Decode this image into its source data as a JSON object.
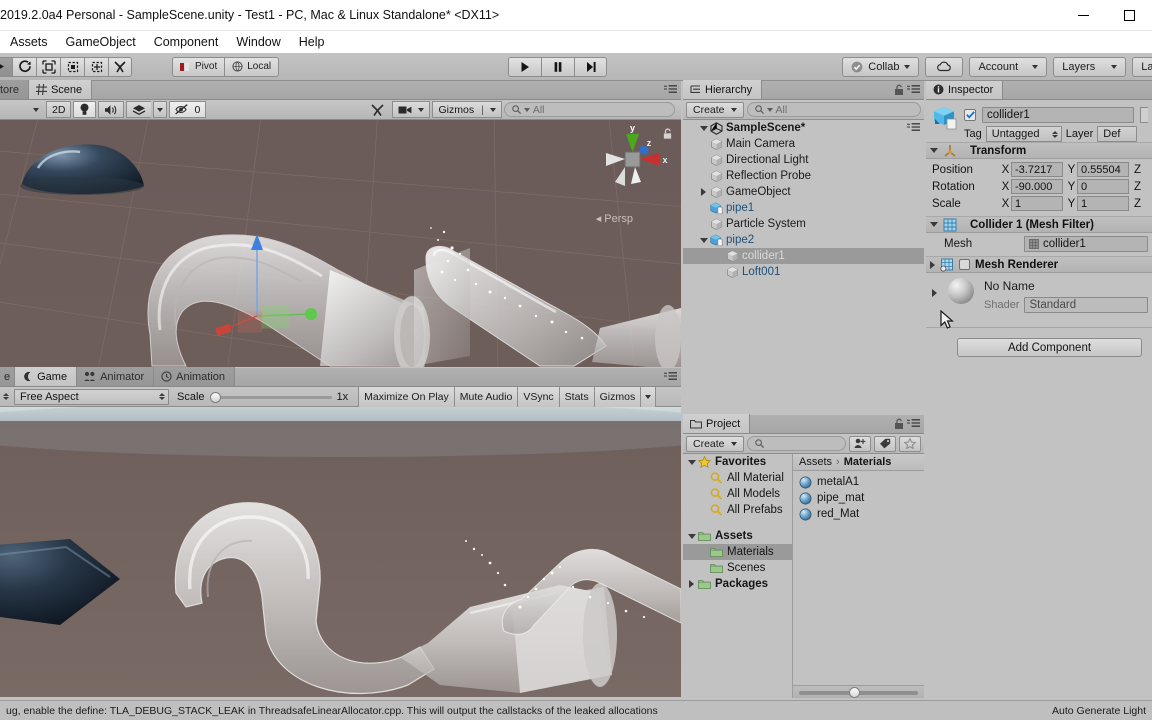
{
  "window": {
    "title": "2019.2.0a4 Personal - SampleScene.unity - Test1 - PC, Mac & Linux Standalone* <DX11>",
    "minimize_icon": "minimize-icon",
    "maximize_icon": "maximize-icon"
  },
  "menubar": {
    "items": [
      "Assets",
      "GameObject",
      "Component",
      "Window",
      "Help"
    ]
  },
  "toolbar": {
    "transform_tools": [
      "hand-tool",
      "move-tool",
      "rotate-tool",
      "scale-tool",
      "rect-tool",
      "transform-tool"
    ],
    "pivot_label": "Pivot",
    "local_label": "Local",
    "play_label": "play-icon",
    "pause_label": "pause-icon",
    "step_label": "step-icon",
    "collab_label": "Collab",
    "cloud_label": "cloud-icon",
    "account_label": "Account",
    "layers_label": "Layers",
    "layout_label": "Lay"
  },
  "scene_view": {
    "tab_partial": "tore",
    "tab_label": "Scene",
    "toolbar": {
      "draw_mode": "",
      "two_d": "2D",
      "lighting": "light-icon",
      "audio": "audio-icon",
      "fx": "fx-icon",
      "hidden_count": "0",
      "tools": "tools-icon",
      "camera": "camera-icon",
      "gizmos": "Gizmos",
      "search_placeholder": "All"
    },
    "gizmo": {
      "x": "x",
      "y": "y",
      "z": "z",
      "projection": "Persp"
    }
  },
  "game_view": {
    "tabs": [
      {
        "label": "Game",
        "icon": "game-icon",
        "active": true
      },
      {
        "label": "Animator",
        "icon": "animator-icon",
        "active": false
      },
      {
        "label": "Animation",
        "icon": "animation-icon",
        "active": false
      }
    ],
    "toolbar": {
      "aspect": "Free Aspect",
      "scale_label": "Scale",
      "scale_value": "1x",
      "maximize": "Maximize On Play",
      "mute": "Mute Audio",
      "vsync": "VSync",
      "stats": "Stats",
      "gizmos": "Gizmos"
    }
  },
  "hierarchy": {
    "tab_label": "Hierarchy",
    "create_label": "Create",
    "search_placeholder": "All",
    "scene_name": "SampleScene*",
    "items": [
      {
        "label": "Main Camera",
        "indent": 2,
        "expandable": false,
        "expanded": false,
        "icon": "gameobject-icon",
        "selected": false
      },
      {
        "label": "Directional Light",
        "indent": 2,
        "expandable": false,
        "expanded": false,
        "icon": "gameobject-icon",
        "selected": false
      },
      {
        "label": "Reflection Probe",
        "indent": 2,
        "expandable": false,
        "expanded": false,
        "icon": "gameobject-icon",
        "selected": false
      },
      {
        "label": "GameObject",
        "indent": 2,
        "expandable": true,
        "expanded": false,
        "icon": "gameobject-icon",
        "selected": false
      },
      {
        "label": "pipe1",
        "indent": 2,
        "expandable": false,
        "expanded": false,
        "icon": "prefab-icon",
        "selected": false
      },
      {
        "label": "Particle System",
        "indent": 2,
        "expandable": false,
        "expanded": false,
        "icon": "gameobject-icon",
        "selected": false
      },
      {
        "label": "pipe2",
        "indent": 2,
        "expandable": true,
        "expanded": true,
        "icon": "prefab-icon",
        "selected": false
      },
      {
        "label": "collider1",
        "indent": 3,
        "expandable": false,
        "expanded": false,
        "icon": "gameobject-icon",
        "selected": true
      },
      {
        "label": "Loft001",
        "indent": 3,
        "expandable": false,
        "expanded": false,
        "icon": "gameobject-icon",
        "selected": false
      }
    ]
  },
  "project": {
    "tab_label": "Project",
    "create_label": "Create",
    "search_placeholder": "",
    "breadcrumb": [
      "Assets",
      "Materials"
    ],
    "tree": [
      {
        "label": "Favorites",
        "indent": 0,
        "expandable": true,
        "expanded": true,
        "icon": "star-icon",
        "bold": true,
        "selected": false
      },
      {
        "label": "All Material",
        "indent": 1,
        "expandable": false,
        "expanded": false,
        "icon": "search-icon",
        "bold": false,
        "selected": false
      },
      {
        "label": "All Models",
        "indent": 1,
        "expandable": false,
        "expanded": false,
        "icon": "search-icon",
        "bold": false,
        "selected": false
      },
      {
        "label": "All Prefabs",
        "indent": 1,
        "expandable": false,
        "expanded": false,
        "icon": "search-icon",
        "bold": false,
        "selected": false
      },
      {
        "label": "",
        "indent": 0,
        "expandable": false,
        "expanded": false,
        "icon": "spacer",
        "bold": false,
        "selected": false
      },
      {
        "label": "Assets",
        "indent": 0,
        "expandable": true,
        "expanded": true,
        "icon": "folder-icon",
        "bold": true,
        "selected": false
      },
      {
        "label": "Materials",
        "indent": 1,
        "expandable": false,
        "expanded": false,
        "icon": "folder-icon",
        "bold": false,
        "selected": true
      },
      {
        "label": "Scenes",
        "indent": 1,
        "expandable": false,
        "expanded": false,
        "icon": "folder-icon",
        "bold": false,
        "selected": false
      },
      {
        "label": "Packages",
        "indent": 0,
        "expandable": true,
        "expanded": false,
        "icon": "folder-icon",
        "bold": true,
        "selected": false
      }
    ],
    "assets": [
      {
        "label": "metalA1",
        "icon": "material-icon"
      },
      {
        "label": "pipe_mat",
        "icon": "material-icon"
      },
      {
        "label": "red_Mat",
        "icon": "material-icon"
      }
    ]
  },
  "inspector": {
    "tab_label": "Inspector",
    "object_name": "collider1",
    "enabled": true,
    "tag_label": "Tag",
    "tag_value": "Untagged",
    "layer_label": "Layer",
    "layer_value": "Def",
    "transform": {
      "title": "Transform",
      "rows": [
        {
          "label": "Position",
          "x": "-3.7217",
          "y": "0.55504"
        },
        {
          "label": "Rotation",
          "x": "-90.000",
          "y": "0"
        },
        {
          "label": "Scale",
          "x": "1",
          "y": "1"
        }
      ]
    },
    "mesh_filter": {
      "title": "Collider 1 (Mesh Filter)",
      "mesh_label": "Mesh",
      "mesh_value": "collider1"
    },
    "mesh_renderer": {
      "title": "Mesh Renderer",
      "enabled": false
    },
    "material": {
      "name": "No Name",
      "shader_label": "Shader",
      "shader_value": "Standard"
    },
    "add_component_label": "Add Component"
  },
  "statusbar": {
    "message": "ug, enable the define: TLA_DEBUG_STACK_LEAK in ThreadsafeLinearAllocator.cpp. This will output the callstacks of the leaked allocations",
    "right_label": "Auto Generate Light"
  },
  "colors": {
    "chrome": "#c2c2c2",
    "scene_bg": "#6a5a57",
    "selection": "#9a9a9a",
    "axis_x": "#c83030",
    "axis_y": "#4aa81e",
    "axis_z": "#2f6fd0"
  }
}
